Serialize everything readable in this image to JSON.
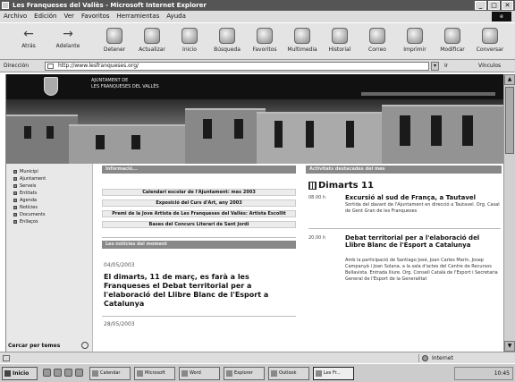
{
  "window": {
    "title": "Les Franqueses del Vallès - Microsoft Internet Explorer",
    "controls": [
      "_",
      "□",
      "✕"
    ]
  },
  "menu": [
    "Archivo",
    "Edición",
    "Ver",
    "Favoritos",
    "Herramientas",
    "Ayuda"
  ],
  "toolbar": {
    "back": "Atrás",
    "forward": "Adelante",
    "buttons": [
      "Detener",
      "Actualizar",
      "Inicio",
      "Búsqueda",
      "Favoritos",
      "Multimedia",
      "Historial",
      "Correo",
      "Imprimir",
      "Modificar",
      "Conversar"
    ]
  },
  "address": {
    "label": "Dirección",
    "url": "http://www.lesfranqueses.org/",
    "go": "Ir",
    "links": "Vínculos"
  },
  "site": {
    "name_line1": "AJUNTAMENT DE",
    "name_line2": "LES FRANQUESES DEL VALLÈS"
  },
  "nav": {
    "items": [
      "Municipi",
      "Ajuntament",
      "Serveis",
      "Entitats",
      "Agenda",
      "Notícies",
      "Documents",
      "Enllaços"
    ],
    "footer": "Cercar per temes"
  },
  "middle": {
    "header1": "Informació...",
    "links": [
      "Calendari escolar de l'Ajuntament: mes 2003",
      "Exposició del Curs d'Art, any 2003",
      "Premi de la Jove Artista de Les Franqueses del Vallès: Artista Escollit",
      "Bases del Concurs Literari de Sant Jordi"
    ],
    "header2": "Les notícies del moment",
    "news1_date": "04/05/2003",
    "news1_title": "El dimarts, 11 de març, es farà a les Franqueses el Debat territorial per a l'elaboració del Llibre Blanc de l'Esport a Catalunya",
    "news2_date": "28/05/2003"
  },
  "agenda": {
    "header": "Activitats destacades del mes",
    "big": "Dimarts 11",
    "items": [
      {
        "date": "08.00 h",
        "title": "Excursió al sud de França, a Tautavel",
        "body": "Sortida del davant de l'Ajuntament en direcció a Tautavel. Org. Casal de Gent Gran de les Franqueses"
      },
      {
        "date": "20.00 h",
        "title": "Debat territorial per a l'elaboració del Llibre Blanc de l'Esport a Catalunya",
        "body": "Amb la participació de Santiago José, Joan Carles Marín, Josep Campanyà i Joan Solana, a la sala d'actes del Centre de Recursos Bellavista. Entrada lliure. Org. Consell Català de l'Esport i Secretaria General de l'Esport de la Generalitat"
      }
    ]
  },
  "status": {
    "zone": "Internet"
  },
  "taskbar": {
    "start": "Inicio",
    "tasks": [
      "Calendar",
      "Microsoft",
      "Word",
      "Explorer",
      "Outlook",
      "Les Fr..."
    ],
    "clock": "10:45"
  }
}
